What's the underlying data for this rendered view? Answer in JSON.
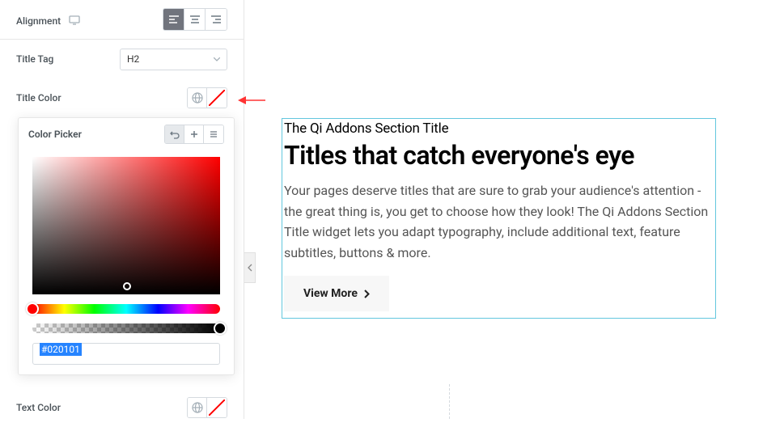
{
  "sidebar": {
    "alignment": {
      "label": "Alignment"
    },
    "titleTag": {
      "label": "Title Tag",
      "value": "H2"
    },
    "titleColor": {
      "label": "Title Color"
    },
    "textColor": {
      "label": "Text Color"
    }
  },
  "colorPicker": {
    "title": "Color Picker",
    "hex": "#020101"
  },
  "preview": {
    "subtitle": "The Qi Addons Section Title",
    "title": "Titles that catch everyone's eye",
    "description": "Your pages deserve titles that are sure to grab your audience's attention - the great thing is, you get to choose how they look! The Qi Addons Section Title widget lets you adapt typography, include additional text, feature subtitles, buttons & more.",
    "buttonLabel": "View More"
  }
}
